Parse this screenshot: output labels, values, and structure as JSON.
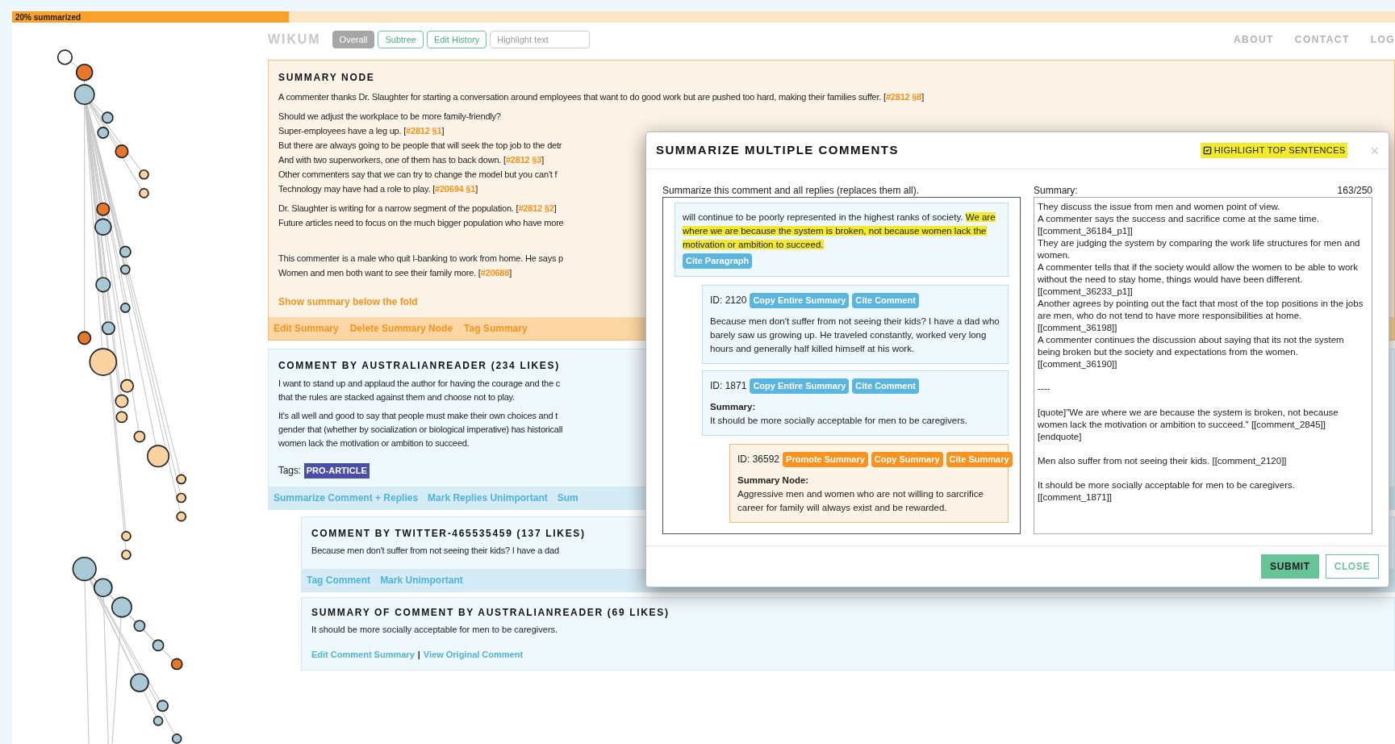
{
  "progress": {
    "label": "20% summarized",
    "level": 0.2
  },
  "header": {
    "logo": "WIKUM",
    "tabs": [
      {
        "label": "Overall",
        "selected": true
      },
      {
        "label": "Subtree",
        "selected": false
      },
      {
        "label": "Edit History",
        "selected": false
      }
    ],
    "search": {
      "placeholder": "Highlight text"
    },
    "nav": [
      "ABOUT",
      "CONTACT",
      "LOG"
    ]
  },
  "summary_node": {
    "title": "SUMMARY NODE",
    "paragraphs": [
      [
        {
          "text": "A commenter thanks Dr. Slaughter for starting a conversation around employees that want to do good work but are pushed too hard, making their families suffer. [",
          "cite": "#2812 §8",
          "after": "]"
        }
      ],
      [
        {
          "text": "Should we adjust the workplace to be more family-friendly?"
        },
        {
          "text": "Super-employees have a leg up. [",
          "cite": "#2812 §1",
          "after": "]"
        },
        {
          "text": "But there are always going to be people that will seek the top job to the detr"
        },
        {
          "text": "And with two superworkers, one of them has to back down. [",
          "cite": "#2812 §3",
          "after": "]"
        },
        {
          "text": "Other commenters say that we can try to change the model but you can't f"
        },
        {
          "text": "Technology may have had a role to play. [",
          "cite": "#20694 §1",
          "after": "]"
        }
      ],
      [
        {
          "text": "Dr. Slaughter is writing for a narrow segment of the population. [",
          "cite": "#2812 §2",
          "after": "]"
        },
        {
          "text": "Future articles need to focus on the much bigger population who have more"
        }
      ],
      [
        {
          "text": "This commenter is a male who quit I-banking to work from home. He says p"
        },
        {
          "text": "Women and men both want to see their family more. [",
          "cite": "#20688",
          "after": "]"
        }
      ]
    ],
    "more_link": "Show summary below the fold",
    "actions": [
      "Edit Summary",
      "Delete Summary Node",
      "Tag Summary"
    ]
  },
  "comment": {
    "title": "COMMENT BY AUSTRALIANREADER (234 LIKES)",
    "paragraphs": [
      [
        "I want to stand up and applaud the author for having the courage and the c",
        "that the rules are stacked against them and choose not to play."
      ],
      [
        "It's all well and good to say that people must make their own choices and t",
        "gender that (whether by socialization or biological imperative) has historicall",
        "women lack the motivation or ambition to succeed."
      ]
    ],
    "tags_label": "Tags:",
    "tags": [
      "PRO-ARTICLE"
    ],
    "actions": [
      "Summarize Comment + Replies",
      "Mark Replies Unimportant",
      "Sum"
    ]
  },
  "reply": {
    "title": "COMMENT BY TWITTER-465535459 (137 LIKES)",
    "text": "Because men don't suffer from not seeing their kids? I have a dad",
    "actions": [
      "Tag Comment",
      "Mark Unimportant"
    ]
  },
  "comment_summary": {
    "title": "SUMMARY OF COMMENT BY AUSTRALIANREADER (69 LIKES)",
    "text": "It should be more socially acceptable for men to be caregivers.",
    "links": [
      "Edit Comment Summary",
      "View Original Comment"
    ],
    "separator": "|"
  },
  "modal": {
    "title": "SUMMARIZE MULTIPLE COMMENTS",
    "highlight_toggle": {
      "label": "HIGHLIGHT TOP SENTENCES",
      "checked": true
    },
    "close": "×",
    "left_label": "Summarize this comment and all replies (replaces them all).",
    "items": [
      {
        "kind": "paragraph",
        "text": "will continue to be poorly represented in the highest ranks of society. ",
        "highlight": "We are where we are because the system is broken, not because women lack the motivation or ambition to succeed.",
        "buttons": [
          "Cite Paragraph"
        ],
        "children": [
          {
            "kind": "comment",
            "id": "ID: 2120",
            "buttons": [
              "Copy Entire Summary",
              "Cite Comment"
            ],
            "text": "Because men don't suffer from not seeing their kids? I have a dad who barely saw us growing up. He traveled constantly, worked very long hours and generally half killed himself at his work."
          },
          {
            "kind": "comment",
            "id": "ID: 1871",
            "buttons": [
              "Copy Entire Summary",
              "Cite Comment"
            ],
            "summary_label": "Summary:",
            "text": "It should be more socially acceptable for men to be caregivers.",
            "children": [
              {
                "kind": "summary",
                "id": "ID: 36592",
                "buttons": [
                  "Promote Summary",
                  "Copy Summary",
                  "Cite Summary"
                ],
                "summary_label": "Summary Node:",
                "text": "Aggressive men and women who are not willing to sarcrifice career for family will always exist and be rewarded."
              }
            ]
          }
        ]
      }
    ],
    "right_label": "Summary:",
    "count": "163/250",
    "summary_value": "They discuss the issue from men and women point of view.\nA commenter says the success and sacrifice come at the same time. [[comment_36184_p1]]\nThey are judging the system by comparing the work life structures for men and women.\nA commenter tells that if the society would allow the women to be able to work without the need to stay home, things would have been different. [[comment_36233_p1]]\nAnother agrees by pointing out the fact that most of the top positions in the jobs are men, who do not tend to have more responsibilities at home. [[comment_36198]]\nA commenter continues the discussion about saying that its not the system being broken but the society and expectations from the women. [[comment_36190]]\n\n----\n\n[quote]\"We are where we are because the system is broken, not because women lack the motivation or ambition to succeed.\" [[comment_2845]] [endquote]\n\nMen also suffer from not seeing their kids. [[comment_2120]]\n\nIt should be more socially acceptable for men to be caregivers. [[comment_1871]]",
    "buttons": [
      {
        "label": "SUBMIT",
        "kind": "primary"
      },
      {
        "label": "CLOSE",
        "kind": "secondary"
      }
    ]
  }
}
